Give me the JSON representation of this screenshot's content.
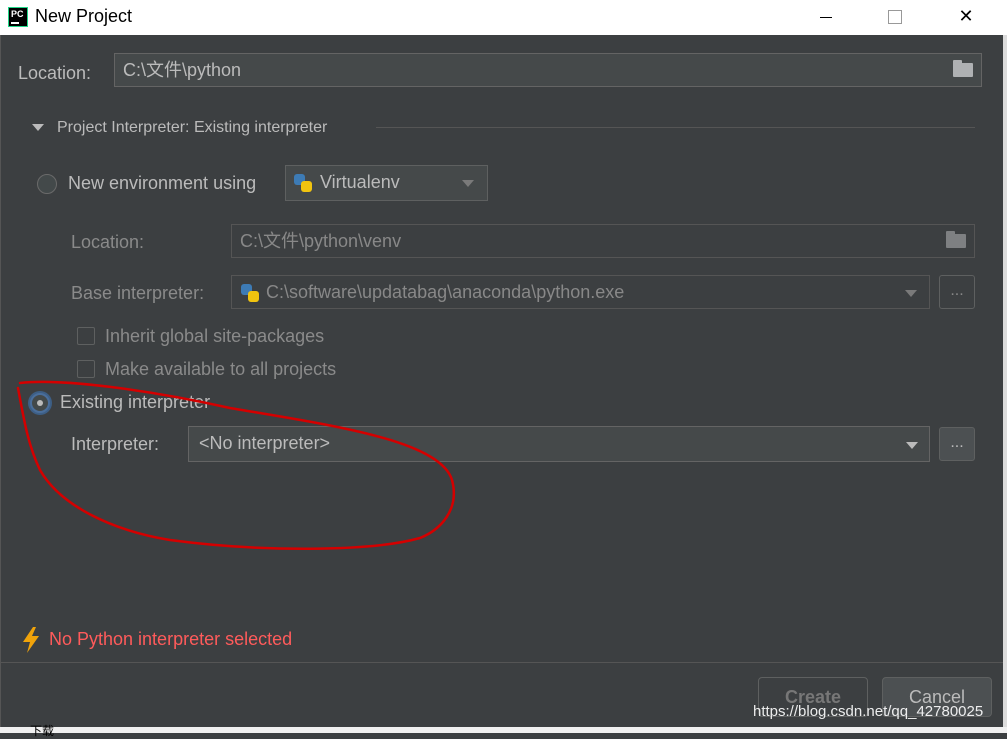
{
  "window": {
    "title": "New Project",
    "app_icon": "PC"
  },
  "location": {
    "label": "Location:",
    "value": "C:\\文件\\python"
  },
  "interpreter_section": {
    "title": "Project Interpreter: Existing interpreter"
  },
  "new_env": {
    "label": "New environment using",
    "tool": "Virtualenv",
    "location_label": "Location:",
    "location_value": "C:\\文件\\python\\venv",
    "base_label": "Base interpreter:",
    "base_value": "C:\\software\\updatabag\\anaconda\\python.exe",
    "browse": "...",
    "inherit_label": "Inherit global site-packages",
    "make_available_label": "Make available to all projects"
  },
  "existing": {
    "label": "Existing interpreter",
    "interpreter_label": "Interpreter:",
    "interpreter_value": "<No interpreter>",
    "browse": "..."
  },
  "status": {
    "error_text": "No Python interpreter selected",
    "error_color": "#ff5b5b"
  },
  "buttons": {
    "create": "Create",
    "cancel": "Cancel"
  },
  "watermark": "https://blog.csdn.net/qq_42780025",
  "background_text": "下载",
  "colors": {
    "dialog_bg": "#3c3f41",
    "annotation": "#d40000"
  }
}
